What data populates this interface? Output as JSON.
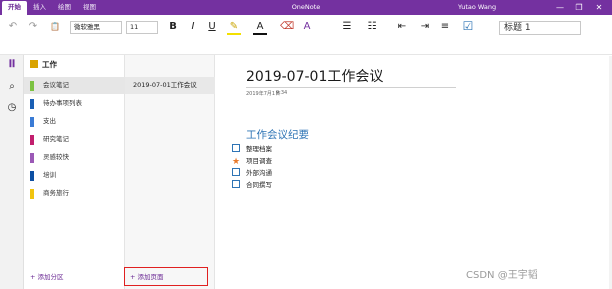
{
  "titlebar": {
    "tabs": [
      "开始",
      "插入",
      "绘图",
      "视图"
    ],
    "app_title": "OneNote",
    "user_name": "Yutao Wang",
    "buttons": {
      "minimize": "—",
      "restore": "❐",
      "close": "✕"
    }
  },
  "ribbon": {
    "font_name": "微软雅黑",
    "font_size": "11",
    "style": "标题 1",
    "icons": {
      "undo": "↶",
      "redo": "↷",
      "paste": "📋",
      "bold": "B",
      "italic": "I",
      "underline": "U",
      "highlight": "✎",
      "font_color": "A",
      "clear_format": "⌫",
      "bullets": "☰",
      "numbering": "☷",
      "outdent": "⇤",
      "indent": "⇥",
      "align": "≡",
      "todo_tag": "☑"
    }
  },
  "sidebar_rail": {
    "icons": {
      "notebooks": "𝐈𝐈",
      "search": "⌕",
      "recent": "◷"
    }
  },
  "notebook": {
    "name": "工作",
    "color": "#d9a300",
    "sections": [
      {
        "label": "会议笔记",
        "color": "#7cc242",
        "active": true
      },
      {
        "label": "待办事项列表",
        "color": "#1a5fb4",
        "active": false
      },
      {
        "label": "支出",
        "color": "#3a7bd5",
        "active": false
      },
      {
        "label": "研究笔记",
        "color": "#c21f6e",
        "active": false
      },
      {
        "label": "灵感较快",
        "color": "#9b59b6",
        "active": false
      },
      {
        "label": "培训",
        "color": "#0d4fa3",
        "active": false
      },
      {
        "label": "商务旅行",
        "color": "#f1c40f",
        "active": false
      }
    ],
    "add_section": "+ 添加分区"
  },
  "pages": {
    "items": [
      "2019-07-01工作会议"
    ],
    "add_page": "+ 添加页面"
  },
  "page": {
    "title": "2019-07-01工作会议",
    "date": "2019年7月1日",
    "time": "9:34",
    "heading": "工作会议纪要",
    "todos": [
      {
        "mark": "checkbox",
        "text": "整理档案"
      },
      {
        "mark": "star",
        "text": "项目调查"
      },
      {
        "mark": "checkbox",
        "text": "外部沟通"
      },
      {
        "mark": "checkbox",
        "text": "合同撰写"
      }
    ]
  },
  "watermark": "CSDN @王宇韬"
}
